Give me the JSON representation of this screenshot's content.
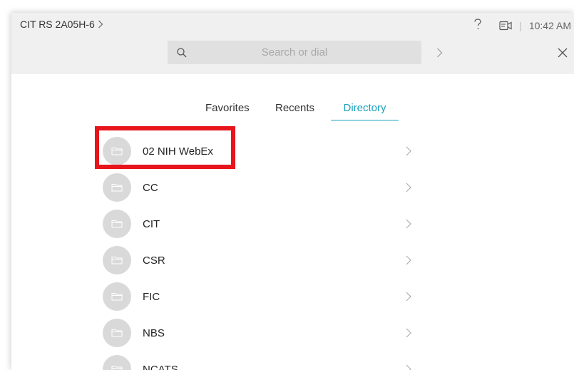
{
  "header": {
    "room_name": "CIT RS 2A05H-6",
    "time": "10:42 AM"
  },
  "search": {
    "placeholder": "Search or dial"
  },
  "tabs": [
    {
      "label": "Favorites"
    },
    {
      "label": "Recents"
    },
    {
      "label": "Directory"
    }
  ],
  "active_tab": "Directory",
  "directory": {
    "items": [
      {
        "label": "02 NIH WebEx"
      },
      {
        "label": "CC"
      },
      {
        "label": "CIT"
      },
      {
        "label": "CSR"
      },
      {
        "label": "FIC"
      },
      {
        "label": "NBS"
      },
      {
        "label": "NCATS"
      }
    ]
  },
  "colors": {
    "accent": "#1aa0be",
    "highlight": "#e8141c",
    "avatar": "#d9d9d9",
    "topbar": "#f0f0f0"
  }
}
